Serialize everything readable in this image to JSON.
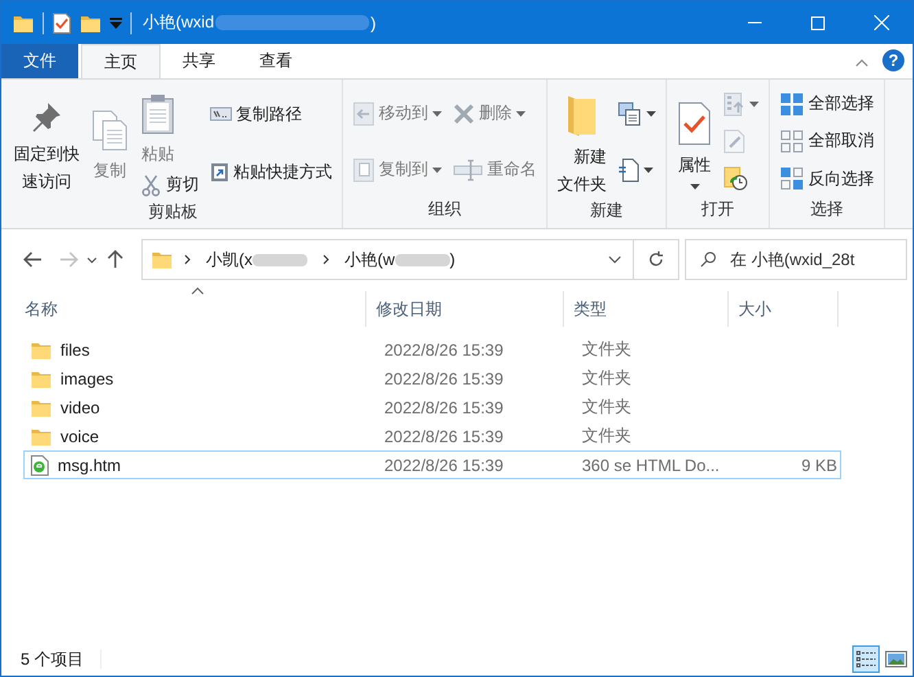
{
  "window": {
    "title": "小艳(wxid",
    "title_end": ")",
    "help": "?"
  },
  "ribbon_tabs": [
    {
      "label": "文件",
      "kind": "file",
      "selected": false
    },
    {
      "label": "主页",
      "kind": "tab",
      "selected": true
    },
    {
      "label": "共享",
      "kind": "tab",
      "selected": false
    },
    {
      "label": "查看",
      "kind": "tab",
      "selected": false
    }
  ],
  "ribbon_groups": [
    {
      "label": "剪贴板",
      "columns": [
        [
          {
            "kind": "large",
            "label": "固定到快速访问",
            "disabled": false
          }
        ],
        [
          {
            "kind": "large",
            "label": "复制",
            "disabled": true
          }
        ],
        [
          {
            "kind": "large",
            "label": "粘贴",
            "disabled": true
          },
          {
            "kind": "small",
            "label": "剪切",
            "disabled": false
          }
        ],
        [
          {
            "kind": "small",
            "label": "复制路径",
            "disabled": false
          },
          {
            "kind": "small",
            "label": "粘贴快捷方式",
            "disabled": false
          }
        ]
      ]
    },
    {
      "label": "组织",
      "columns": [
        [
          {
            "kind": "small",
            "label": "移动到",
            "disabled": true,
            "dropdown": true
          },
          {
            "kind": "small",
            "label": "复制到",
            "disabled": true,
            "dropdown": true
          }
        ],
        [
          {
            "kind": "small",
            "label": "删除",
            "disabled": true,
            "dropdown": true
          },
          {
            "kind": "small",
            "label": "重命名",
            "disabled": true
          }
        ]
      ]
    },
    {
      "label": "新建",
      "columns": [
        [
          {
            "kind": "large",
            "label": "新建文件夹",
            "disabled": false
          }
        ],
        [
          {
            "kind": "icon",
            "disabled": false,
            "dropdown": true
          },
          {
            "kind": "icon",
            "disabled": false,
            "dropdown": true
          }
        ]
      ]
    },
    {
      "label": "打开",
      "columns": [
        [
          {
            "kind": "large",
            "label": "属性",
            "disabled": false,
            "dropdown": true
          }
        ],
        [
          {
            "kind": "icon",
            "disabled": true,
            "dropdown": true
          },
          {
            "kind": "icon",
            "disabled": true
          },
          {
            "kind": "icon",
            "disabled": false
          }
        ]
      ]
    },
    {
      "label": "选择",
      "columns": [
        [
          {
            "kind": "small",
            "label": "全部选择",
            "disabled": false
          },
          {
            "kind": "small",
            "label": "全部取消",
            "disabled": false
          },
          {
            "kind": "small",
            "label": "反向选择",
            "disabled": false
          }
        ]
      ]
    }
  ],
  "navigation": {
    "back_disabled": false,
    "forward_disabled": true
  },
  "address": {
    "segments": [
      {
        "text": "小凯(x",
        "redacted": true
      },
      {
        "text": "小艳(w",
        "redacted": true,
        "end": ")"
      }
    ]
  },
  "search": {
    "placeholder": "在 小艳(wxid_28t"
  },
  "table": {
    "columns": [
      {
        "label": "名称",
        "sorted": true
      },
      {
        "label": "修改日期",
        "sorted": false
      },
      {
        "label": "类型",
        "sorted": false
      },
      {
        "label": "大小",
        "sorted": false
      }
    ],
    "rows": [
      {
        "kind": "folder",
        "name": "files",
        "date": "2022/8/26 15:39",
        "type": "文件夹",
        "focused": false
      },
      {
        "kind": "folder",
        "name": "images",
        "date": "2022/8/26 15:39",
        "type": "文件夹",
        "focused": false
      },
      {
        "kind": "folder",
        "name": "video",
        "date": "2022/8/26 15:39",
        "type": "文件夹",
        "focused": false
      },
      {
        "kind": "folder",
        "name": "voice",
        "date": "2022/8/26 15:39",
        "type": "文件夹",
        "focused": false
      },
      {
        "kind": "html",
        "name": "msg.htm",
        "date": "2022/8/26 15:39",
        "type": "360 se HTML Do...",
        "size": "9 KB",
        "focused": true
      }
    ]
  },
  "status_bar": {
    "count": "5 个项目",
    "views": [
      {
        "kind": "details",
        "selected": true
      },
      {
        "kind": "large_icons",
        "selected": false
      }
    ]
  }
}
